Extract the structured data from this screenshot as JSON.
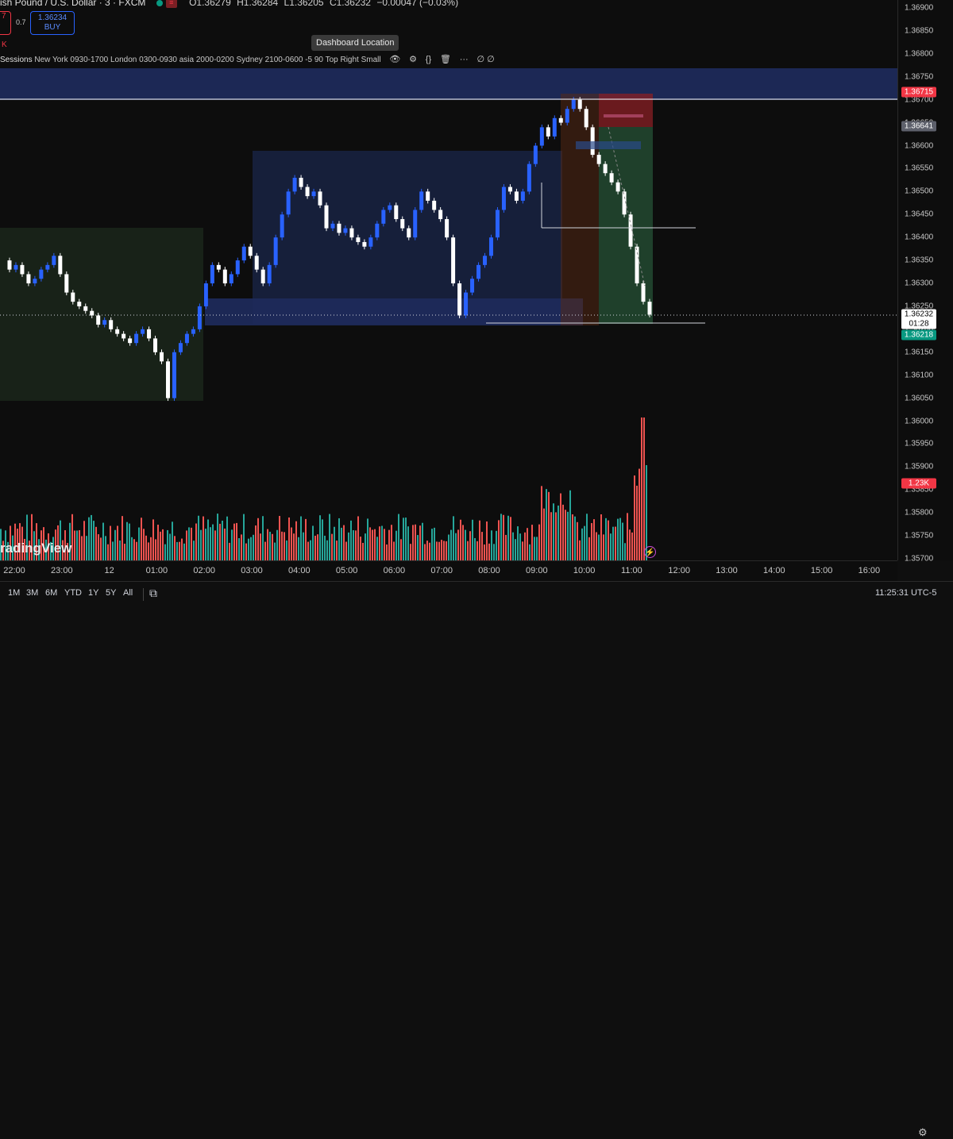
{
  "header": {
    "symbol": "ish Pound / U.S. Dollar · 3 · FXCM",
    "open": "O1.36279",
    "high": "H1.36284",
    "low": "L1.36205",
    "close": "C1.36232",
    "change": "−0.00047 (−0.03%)",
    "sell_fragment": "7",
    "spread": "0.7",
    "buy_price": "1.36234",
    "buy_label": "BUY",
    "k_fragment": "K"
  },
  "tooltip": "Dashboard Location",
  "indicator": {
    "title": "Sessions",
    "params": "New York 0930-1700 London 0300-0930 asia 2000-0200 Sydney 2100-0600 -5 90 Top Right Small",
    "values": "∅ ∅"
  },
  "watermark": "radingView",
  "price_axis": {
    "ticks": [
      "1.36900",
      "1.36850",
      "1.36800",
      "1.36750",
      "1.36700",
      "1.36650",
      "1.36600",
      "1.36550",
      "1.36500",
      "1.36450",
      "1.36400",
      "1.36350",
      "1.36300",
      "1.36250",
      "1.36200",
      "1.36150",
      "1.36100",
      "1.36050",
      "1.36000",
      "1.35950",
      "1.35900",
      "1.35850",
      "1.35800",
      "1.35750",
      "1.35700"
    ],
    "badge_high": "1.36715",
    "badge_mid": "1.36641",
    "badge_current": "1.36232",
    "badge_countdown": "01:28",
    "badge_low": "1.36218",
    "badge_volume": "1.23K"
  },
  "time_axis": {
    "ticks": [
      "22:00",
      "23:00",
      "12",
      "01:00",
      "02:00",
      "03:00",
      "04:00",
      "05:00",
      "06:00",
      "07:00",
      "08:00",
      "09:00",
      "10:00",
      "11:00",
      "12:00",
      "13:00",
      "14:00",
      "15:00",
      "16:00"
    ]
  },
  "bottom_bar": {
    "ranges": [
      "1M",
      "3M",
      "6M",
      "YTD",
      "1Y",
      "5Y",
      "All"
    ],
    "clock": "11:25:31 UTC-5"
  },
  "colors": {
    "up": "#2962ff",
    "down": "#ffffff",
    "vol_up": "#26a69a",
    "vol_down": "#ef5350",
    "asia_zone": "#1c2a1c",
    "ny_zone": "#17213f",
    "london_zone": "#1e2a5a",
    "buy_blue": "#2962ff",
    "sell_red": "#f23645"
  },
  "chart_data": {
    "type": "candlestick",
    "ylim": [
      1.357,
      1.369
    ],
    "series": [
      {
        "name": "price",
        "values": [
          1.3635,
          1.3633,
          1.3634,
          1.3632,
          1.363,
          1.3631,
          1.3633,
          1.3634,
          1.3636,
          1.3632,
          1.3628,
          1.3626,
          1.3625,
          1.3624,
          1.3623,
          1.3621,
          1.3622,
          1.362,
          1.3619,
          1.3618,
          1.3617,
          1.3619,
          1.362,
          1.3618,
          1.3615,
          1.3613,
          1.3605,
          1.3615,
          1.3617,
          1.3619,
          1.362,
          1.3625,
          1.363,
          1.3634,
          1.3633,
          1.363,
          1.3632,
          1.3635,
          1.3638,
          1.3636,
          1.3633,
          1.363,
          1.3634,
          1.364,
          1.3645,
          1.365,
          1.3653,
          1.3651,
          1.3649,
          1.365,
          1.3647,
          1.3642,
          1.3643,
          1.3641,
          1.3642,
          1.364,
          1.3639,
          1.3638,
          1.364,
          1.3643,
          1.3646,
          1.3647,
          1.3644,
          1.3642,
          1.364,
          1.3646,
          1.365,
          1.3648,
          1.3646,
          1.3644,
          1.364,
          1.363,
          1.3623,
          1.3628,
          1.3631,
          1.3634,
          1.3636,
          1.364,
          1.3646,
          1.3651,
          1.365,
          1.3648,
          1.365,
          1.3656,
          1.366,
          1.3664,
          1.3662,
          1.3666,
          1.3665,
          1.3668,
          1.367,
          1.3668,
          1.3664,
          1.3658,
          1.3656,
          1.3654,
          1.3652,
          1.365,
          1.3645,
          1.3638,
          1.363,
          1.3626,
          1.36232
        ]
      }
    ]
  }
}
